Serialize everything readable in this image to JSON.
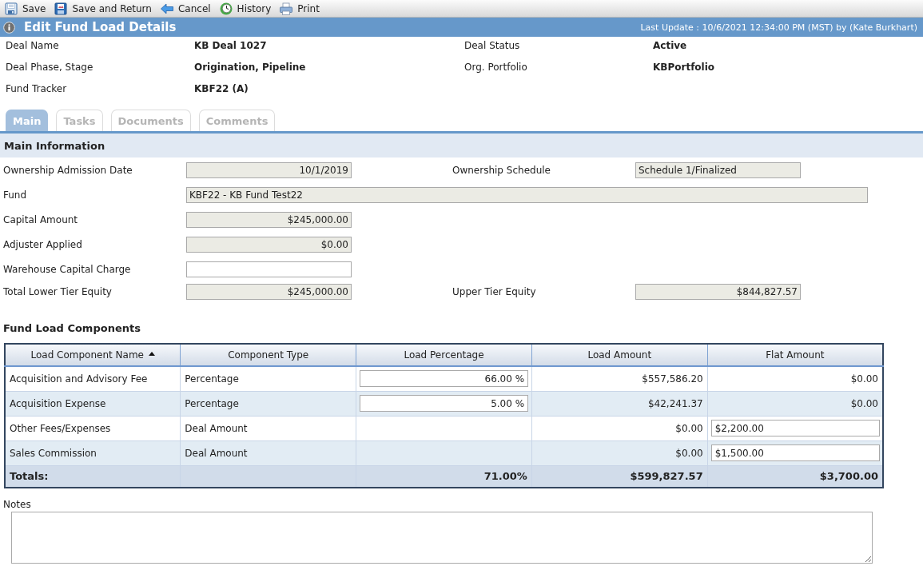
{
  "toolbar": [
    {
      "kind": "save",
      "label": "Save"
    },
    {
      "kind": "save_return",
      "label": "Save and Return"
    },
    {
      "kind": "cancel",
      "label": "Cancel"
    },
    {
      "kind": "history",
      "label": "History"
    },
    {
      "kind": "print",
      "label": "Print"
    }
  ],
  "header": {
    "title": "Edit Fund Load Details",
    "last_update": "Last Update : 10/6/2021 12:34:00 PM (MST) by (Kate Burkhart)"
  },
  "deal_info": [
    {
      "label": "Deal Name",
      "value": "KB Deal 1027"
    },
    {
      "label": "Deal Status",
      "value": "Active"
    },
    {
      "label": "Deal Phase, Stage",
      "value": "Origination, Pipeline"
    },
    {
      "label": "Org. Portfolio",
      "value": "KBPortfolio"
    },
    {
      "label": "Fund Tracker",
      "value": "KBF22 (A)"
    }
  ],
  "tabs": [
    {
      "label": "Main",
      "selected": true
    },
    {
      "label": "Tasks",
      "selected": false
    },
    {
      "label": "Documents",
      "selected": false
    },
    {
      "label": "Comments",
      "selected": false
    }
  ],
  "main_information": {
    "title": "Main Information",
    "rows": [
      {
        "fields": [
          {
            "label": "Ownership Admission Date",
            "value": "10/1/2019",
            "kind": "number",
            "disabled": true
          },
          {
            "label": "Ownership Schedule",
            "value": "Schedule 1/Finalized",
            "kind": "text",
            "disabled": true
          }
        ]
      },
      {
        "fields": [
          {
            "label": "Fund",
            "value": "KBF22 - KB Fund Test22",
            "kind": "long_text",
            "disabled": true
          }
        ]
      },
      {
        "fields": [
          {
            "label": "Capital Amount",
            "value": "$245,000.00",
            "kind": "number",
            "disabled": true
          }
        ]
      },
      {
        "fields": [
          {
            "label": "Adjuster Applied",
            "value": "$0.00",
            "kind": "number",
            "disabled": true
          }
        ]
      },
      {
        "fields": [
          {
            "label": "Warehouse Capital Charge",
            "kind": "number",
            "disabled": false
          }
        ]
      },
      {
        "fields": [
          {
            "label": "Total Lower Tier Equity",
            "value": "$245,000.00",
            "kind": "number",
            "disabled": true
          },
          {
            "label": "Upper Tier Equity",
            "value": "$844,827.57",
            "kind": "number",
            "disabled": true
          }
        ]
      }
    ]
  },
  "fund_load_components": {
    "title": "Fund Load Components",
    "columns": [
      {
        "label": "Load Component Name",
        "sorted": true
      },
      {
        "label": "Component Type",
        "sorted": false
      },
      {
        "label": "Load Percentage",
        "sorted": false
      },
      {
        "label": "Load Amount",
        "sorted": false
      },
      {
        "label": "Flat Amount",
        "sorted": false
      }
    ],
    "rows": [
      {
        "kind": "percentage",
        "name": "Acquisition and Advisory Fee",
        "component_type": "Percentage",
        "load_percentage": "66.00 %",
        "load_amount": "$557,586.20",
        "flat_amount": "$0.00"
      },
      {
        "kind": "percentage",
        "name": "Acquisition Expense",
        "component_type": "Percentage",
        "load_percentage": "5.00 %",
        "load_amount": "$42,241.37",
        "flat_amount": "$0.00"
      },
      {
        "kind": "flat",
        "name": "Other Fees/Expenses",
        "component_type": "Deal Amount",
        "load_amount": "$0.00",
        "flat_amount": "$2,200.00"
      },
      {
        "kind": "flat",
        "name": "Sales Commission",
        "component_type": "Deal Amount",
        "load_amount": "$0.00",
        "flat_amount": "$1,500.00"
      }
    ],
    "totals": {
      "label": "Totals:",
      "load_percentage": "71.00%",
      "load_amount": "$599,827.57",
      "flat_amount": "$3,700.00"
    }
  },
  "notes": {
    "label": "Notes"
  }
}
